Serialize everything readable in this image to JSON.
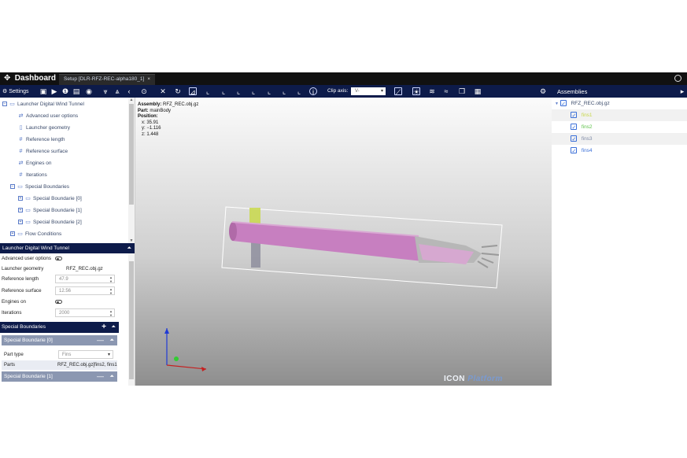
{
  "app": {
    "title": "Dashboard",
    "tab_label": "Setup [DLR-RFZ-REC-alpha180_1]",
    "tab_close": "×"
  },
  "toolbar": {
    "settings_label": "Settings",
    "clip_axis_label": "Clip axis:",
    "clip_axis_value": "V-",
    "assemblies_title": "Assemblies"
  },
  "tree": {
    "root": "Launcher Digital Wind Tunnel",
    "items": [
      "Advanced user options",
      "Launcher geometry",
      "Reference length",
      "Reference surface",
      "Engines on",
      "Iterations",
      "Special Boundaries",
      "Special Boundarie [0]",
      "Special Boundarie [1]",
      "Special Boundarie [2]",
      "Flow Conditions"
    ]
  },
  "properties": {
    "header": "Launcher Digital Wind Tunnel",
    "advanced_user_options": {
      "label": "Advanced user options",
      "value": false
    },
    "launcher_geometry": {
      "label": "Launcher geometry",
      "value": "RFZ_REC.obj.gz"
    },
    "reference_length": {
      "label": "Reference length",
      "value": "47.9"
    },
    "reference_surface": {
      "label": "Reference surface",
      "value": "12.56"
    },
    "engines_on": {
      "label": "Engines on",
      "value": false
    },
    "iterations": {
      "label": "Iterations",
      "value": "2000"
    },
    "special_boundaries": {
      "header": "Special Boundaries",
      "add": "+",
      "sb0": {
        "header": "Special Boundarie [0]",
        "part_type_label": "Part type",
        "part_type_value": "Fins",
        "parts_label": "Parts",
        "parts_value": "RFZ_REC.obj.gz[fins2, fins1"
      },
      "sb1": {
        "header": "Special Boundarie [1]"
      }
    }
  },
  "viewport": {
    "assembly_label": "Assembly:",
    "assembly_value": "RFZ_REC.obj.gz",
    "part_label": "Part:",
    "part_value": "mainBody",
    "position_label": "Position:",
    "x": "x: 35.91",
    "y": "y: −1.116",
    "z": "z: 1.448",
    "brand_icon": "ICON",
    "brand_platform": "Platform"
  },
  "assemblies": {
    "root": "RFZ_REC.obj.gz",
    "items": [
      {
        "name": "fins1",
        "color": "#c8d84a"
      },
      {
        "name": "fins2",
        "color": "#5ec24a"
      },
      {
        "name": "fins3",
        "color": "#7e8aa6"
      },
      {
        "name": "fins4",
        "color": "#3a6fd8"
      }
    ]
  },
  "colors": {
    "header_bg": "#111111",
    "toolbar_bg": "#0d1b4a",
    "body_pink": "#c77fc0",
    "sub_header": "#8b97b1"
  }
}
